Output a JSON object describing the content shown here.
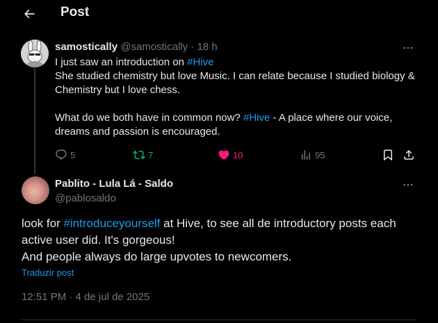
{
  "header": {
    "title": "Post"
  },
  "post1": {
    "name": "samostically",
    "handle": "@samostically",
    "sep": " · ",
    "time": "18 h",
    "line1_pre": "I just saw an introduction on ",
    "line1_tag": "#Hive",
    "line2": "She studied chemistry but love Music. I can relate because I studied biology & Chemistry but I love chess.",
    "line3_pre": "What do we both have in common now? ",
    "line3_tag": "#Hive",
    "line3_post": " - A place where our voice, dreams and passion is encouraged.",
    "replies": "5",
    "reposts": "7",
    "likes": "10",
    "views": "95"
  },
  "post2": {
    "name": "Pablito - Lula Lá - Saldo",
    "handle": "@pablosaldo",
    "text_pre": "look for ",
    "text_tag": "#introduceyourself",
    "text_post": " at Hive, to see all de introductory posts each active user did. It's gorgeous!",
    "text_line2": "And people always do large upvotes to newcomers.",
    "translate": "Traduzir post",
    "timestamp": "12:51 PM · 4 de jul de 2025"
  },
  "icons": {
    "back": "arrow-left-icon",
    "more": "more-horizontal-icon",
    "reply": "reply-icon",
    "repost": "repost-icon",
    "like": "heart-icon",
    "views": "views-icon",
    "bookmark": "bookmark-icon",
    "share": "share-icon"
  },
  "colors": {
    "background": "#000000",
    "text": "#e7e9ea",
    "muted": "#71767b",
    "link": "#1d9bf0",
    "repost": "#00ba7c",
    "like": "#f91880"
  }
}
